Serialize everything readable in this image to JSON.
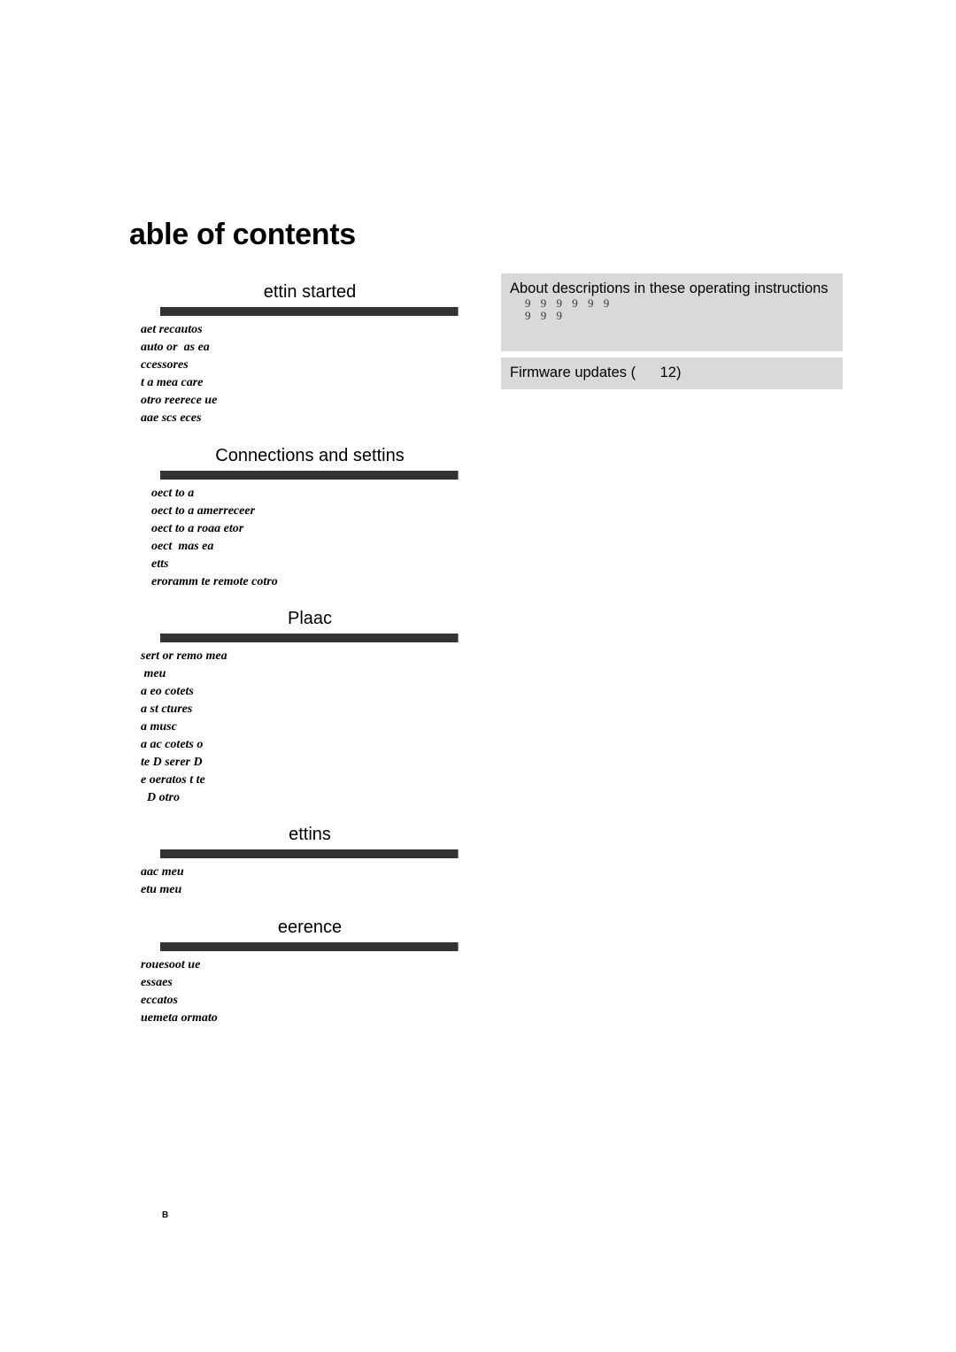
{
  "page": {
    "title": "able of contents",
    "folio": "B"
  },
  "sections": [
    {
      "title": "ettin started",
      "items": [
        "aet recautos",
        "auto or  as ea",
        "ccessores",
        "t a mea care",
        "otro reerece ue",
        "aae scs eces"
      ]
    },
    {
      "title": "Connections and settins",
      "items": [
        "oect to a",
        "oect to a amerreceer",
        "oect to a roaa etor",
        "oect  mas ea",
        "etts",
        "eroramm te remote cotro"
      ]
    },
    {
      "title": "Plaac",
      "items": [
        "sert or remo mea",
        " meu",
        "a eo cotets",
        "a st ctures",
        "a musc",
        "a ac cotets o",
        "te D serer D",
        "e oeratos t te",
        "  D otro"
      ]
    },
    {
      "title": "ettins",
      "items": [
        "aac meu",
        "etu meu"
      ]
    },
    {
      "title": "eerence",
      "items": [
        "rouesoot ue",
        "essaes",
        "eccatos",
        "uemeta ormato"
      ]
    }
  ],
  "sidebar_boxes": [
    {
      "title": "About descriptions in these operating instructions",
      "sub_lines": [
        "9 9 9 9 9 9",
        "9 9 9"
      ]
    },
    {
      "title": "Firmware updates (      12)"
    }
  ]
}
